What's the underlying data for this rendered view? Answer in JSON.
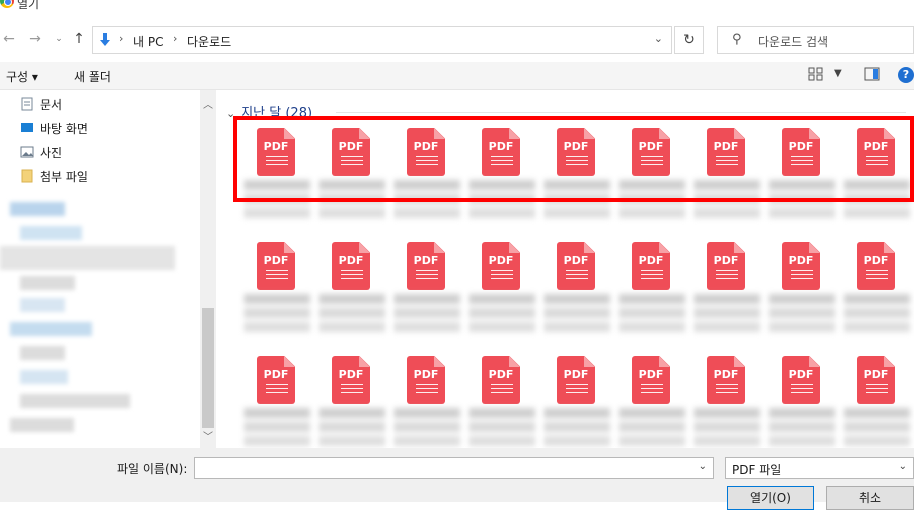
{
  "window": {
    "title": "열기"
  },
  "nav": {
    "breadcrumbs": [
      "내 PC",
      "다운로드"
    ],
    "search_placeholder": "다운로드 검색"
  },
  "toolbar": {
    "organize": "구성",
    "new_folder": "새 폴더"
  },
  "sidebar": {
    "items": [
      {
        "label": "문서",
        "icon": "document-icon"
      },
      {
        "label": "바탕 화면",
        "icon": "desktop-icon"
      },
      {
        "label": "사진",
        "icon": "pictures-icon"
      },
      {
        "label": "첨부 파일",
        "icon": "folder-icon"
      }
    ]
  },
  "content": {
    "group_label": "지난 달 (28)",
    "file_icon_label": "PDF"
  },
  "footer": {
    "filename_label": "파일 이름(N):",
    "filename_value": "",
    "filetype_value": "PDF 파일",
    "open_button": "열기(O)",
    "cancel_button": "취소"
  },
  "colors": {
    "pdf_red": "#ef4d57",
    "highlight": "#ff0000",
    "accent": "#1f6fd1"
  }
}
